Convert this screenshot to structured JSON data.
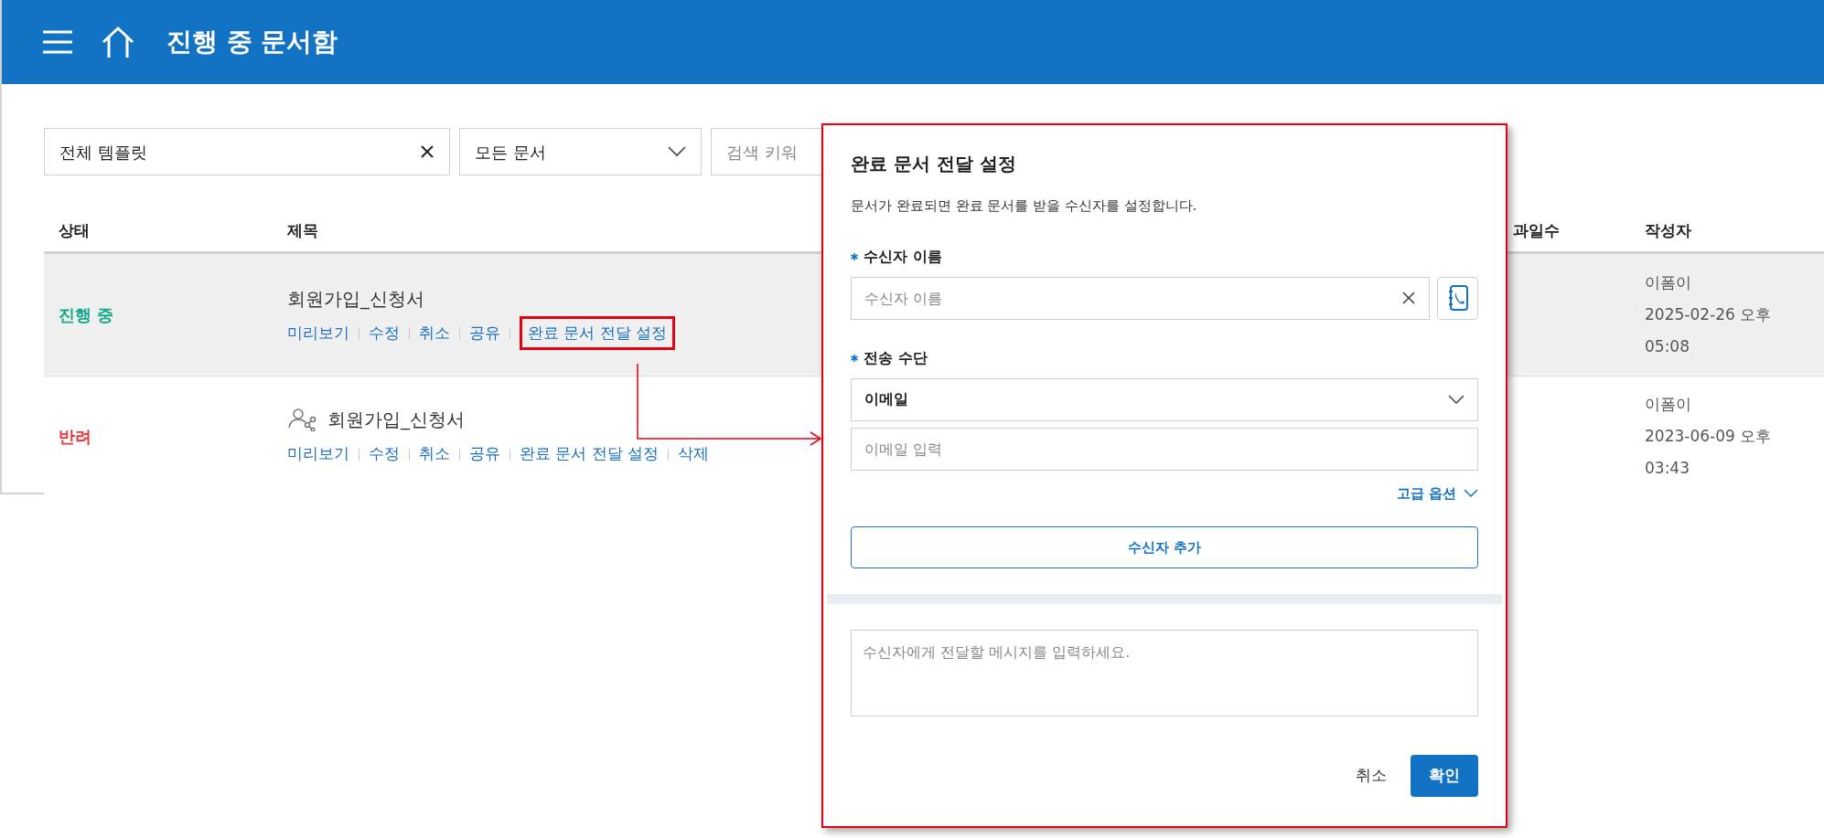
{
  "header": {
    "title": "진행 중 문서함"
  },
  "filters": {
    "template": {
      "value": "전체 템플릿"
    },
    "document_type": {
      "value": "모든 문서"
    },
    "search": {
      "placeholder": "검색 키워"
    }
  },
  "table": {
    "columns": [
      "상태",
      "제목",
      "과일수",
      "작성자"
    ],
    "rows": [
      {
        "selected": true,
        "status": "진행 중",
        "color": "#17a88b",
        "shared": false,
        "title": "회원가입_신청서",
        "actions": [
          {
            "label": "미리보기",
            "highlighted": false
          },
          {
            "label": "수정",
            "highlighted": false
          },
          {
            "label": "취소",
            "highlighted": false
          },
          {
            "label": "공유",
            "highlighted": false
          },
          {
            "label": "완료 문서 전달 설정",
            "highlighted": true
          }
        ],
        "author": "이폼이",
        "date": "2025-02-26 오후",
        "time": "05:08"
      },
      {
        "selected": false,
        "status": "반려",
        "color": "#e8383d",
        "shared": true,
        "title": "회원가입_신청서",
        "actions": [
          {
            "label": "미리보기",
            "highlighted": false
          },
          {
            "label": "수정",
            "highlighted": false
          },
          {
            "label": "취소",
            "highlighted": false
          },
          {
            "label": "공유",
            "highlighted": false
          },
          {
            "label": "완료 문서 전달 설정",
            "highlighted": false
          },
          {
            "label": "삭제",
            "highlighted": false
          }
        ],
        "author": "이폼이",
        "date": "2023-06-09 오후",
        "time": "03:43"
      }
    ]
  },
  "dialog": {
    "title": "완료 문서 전달 설정",
    "description": "문서가 완료되면 완료 문서를 받을 수신자를 설정합니다.",
    "recipient_name": {
      "label": "수신자 이름",
      "required": true,
      "placeholder": "수신자 이름"
    },
    "delivery_method": {
      "label": "전송 수단",
      "required": true,
      "value": "이메일",
      "email_placeholder": "이메일 입력"
    },
    "advanced_options": "고급 옵션",
    "add_recipient": "수신자 추가",
    "message": {
      "placeholder": "수신자에게 전달할 메시지를 입력하세요."
    },
    "buttons": [
      {
        "label": "취소",
        "primary": false
      },
      {
        "label": "확인",
        "primary": true
      }
    ]
  }
}
